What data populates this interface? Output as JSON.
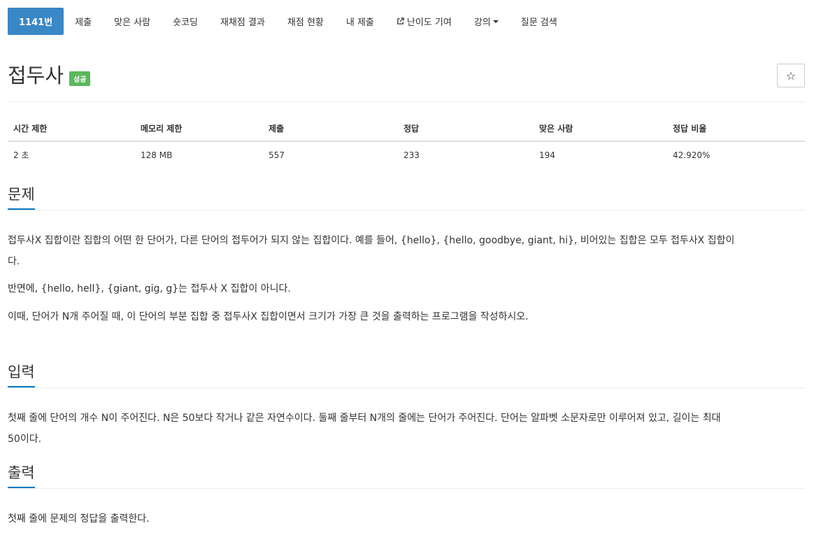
{
  "nav": {
    "items": [
      {
        "label": "1141번"
      },
      {
        "label": "제출"
      },
      {
        "label": "맞은 사람"
      },
      {
        "label": "숏코딩"
      },
      {
        "label": "재채점 결과"
      },
      {
        "label": "채점 현황"
      },
      {
        "label": "내 제출"
      },
      {
        "label": "난이도 기여"
      },
      {
        "label": "강의"
      },
      {
        "label": "질문 검색"
      }
    ]
  },
  "problem": {
    "title": "접두사",
    "badge": "성공"
  },
  "stats": {
    "headers": [
      "시간 제한",
      "메모리 제한",
      "제출",
      "정답",
      "맞은 사람",
      "정답 비율"
    ],
    "values": [
      "2 초",
      "128 MB",
      "557",
      "233",
      "194",
      "42.920%"
    ]
  },
  "sections": {
    "description_title": "문제",
    "description_p1a": "접두사X 집합이란 집합의 어떤 한 단어가, 다른 단어의 접두어가 되지 않는 집합이다. 예를 들어, {hello}, {hello, goodbye, giant, hi}, 비어있는 집합은 모두 접두사X 집합이",
    "description_p1b": "다.",
    "description_p2": "반면에, {hello, hell}, {giant, gig, g}는 접두사 X 집합이 아니다.",
    "description_p3": "이때, 단어가 N개 주어질 때, 이 단어의 부분 집합 중 접두사X 집합이면서 크기가 가장 큰 것을 출력하는 프로그램을 작성하시오.",
    "input_title": "입력",
    "input_p1a": "첫째 줄에 단어의 개수 N이 주어진다. N은 50보다 작거나 같은 자연수이다. 둘째 줄부터 N개의 줄에는 단어가 주어진다. 단어는 알파벳 소문자로만 이루어져 있고, 길이는 최대",
    "input_p1b": "50이다.",
    "output_title": "출력",
    "output_p1": "첫째 줄에 문제의 정답을 출력한다."
  },
  "icons": {
    "star": "star-icon",
    "external": "external-link-icon",
    "caret": "caret-down-icon"
  },
  "colors": {
    "active_tab": "#3a87c6",
    "badge_success": "#5cb85c",
    "section_underline": "#0076c0"
  }
}
